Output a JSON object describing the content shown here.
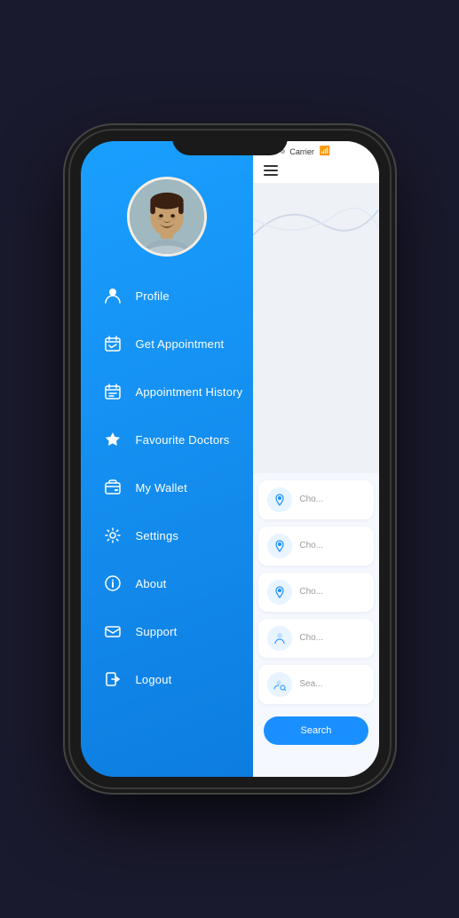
{
  "phone": {
    "status_bar": {
      "signals": [
        "filled",
        "filled",
        "empty",
        "empty"
      ],
      "carrier": "Carrier",
      "wifi": "wifi"
    }
  },
  "sidebar": {
    "menu_items": [
      {
        "id": "profile",
        "icon": "person",
        "label": "Profile"
      },
      {
        "id": "get-appointment",
        "icon": "calendar-check",
        "label": "Get Appointment"
      },
      {
        "id": "appointment-history",
        "icon": "calendar-history",
        "label": "Appointment History"
      },
      {
        "id": "favourite-doctors",
        "icon": "star",
        "label": "Favourite Doctors"
      },
      {
        "id": "my-wallet",
        "icon": "wallet",
        "label": "My Wallet"
      },
      {
        "id": "settings",
        "icon": "gear",
        "label": "Settings"
      },
      {
        "id": "about",
        "icon": "info",
        "label": "About"
      },
      {
        "id": "support",
        "icon": "envelope",
        "label": "Support"
      },
      {
        "id": "logout",
        "icon": "logout",
        "label": "Logout"
      }
    ]
  },
  "content": {
    "items": [
      {
        "text": "Cho..."
      },
      {
        "text": "Cho..."
      },
      {
        "text": "Cho..."
      },
      {
        "text": "Cho..."
      },
      {
        "text": "Sea..."
      }
    ],
    "cta_label": "Search"
  }
}
